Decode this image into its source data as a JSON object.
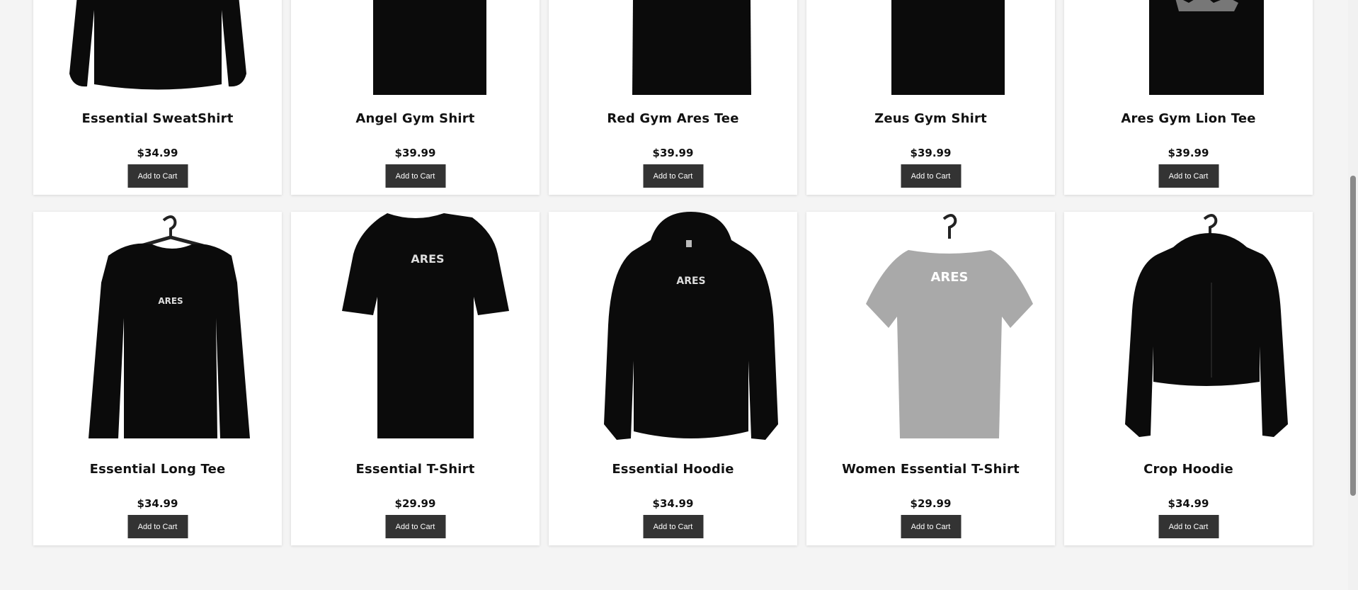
{
  "products": [
    {
      "name": "Essential SweatShirt",
      "price": "$34.99",
      "button": "Add to Cart",
      "image_icon": "sweatshirt-image",
      "print": ""
    },
    {
      "name": "Angel Gym Shirt",
      "price": "$39.99",
      "button": "Add to Cart",
      "image_icon": "shirt-image",
      "print": ""
    },
    {
      "name": "Red Gym Ares Tee",
      "price": "$39.99",
      "button": "Add to Cart",
      "image_icon": "tee-image",
      "print": ""
    },
    {
      "name": "Zeus Gym Shirt",
      "price": "$39.99",
      "button": "Add to Cart",
      "image_icon": "shirt-image",
      "print": ""
    },
    {
      "name": "Ares Gym Lion Tee",
      "price": "$39.99",
      "button": "Add to Cart",
      "image_icon": "tee-image",
      "print": ""
    },
    {
      "name": "Essential Long Tee",
      "price": "$34.99",
      "button": "Add to Cart",
      "image_icon": "long-tee-image",
      "print": "ARES"
    },
    {
      "name": "Essential T-Shirt",
      "price": "$29.99",
      "button": "Add to Cart",
      "image_icon": "tshirt-image",
      "print": "ARES"
    },
    {
      "name": "Essential Hoodie",
      "price": "$34.99",
      "button": "Add to Cart",
      "image_icon": "hoodie-image",
      "print": "ARES"
    },
    {
      "name": "Women Essential T-Shirt",
      "price": "$29.99",
      "button": "Add to Cart",
      "image_icon": "women-tshirt-image",
      "print": "ARES"
    },
    {
      "name": "Crop Hoodie",
      "price": "$34.99",
      "button": "Add to Cart",
      "image_icon": "crop-hoodie-image",
      "print": ""
    }
  ],
  "colors": {
    "page_bg": "#f4f4f4",
    "card_bg": "#ffffff",
    "button_bg": "#333333",
    "button_text": "#ffffff",
    "garment_black": "#0b0b0b",
    "garment_grey": "#a9a9a9"
  }
}
